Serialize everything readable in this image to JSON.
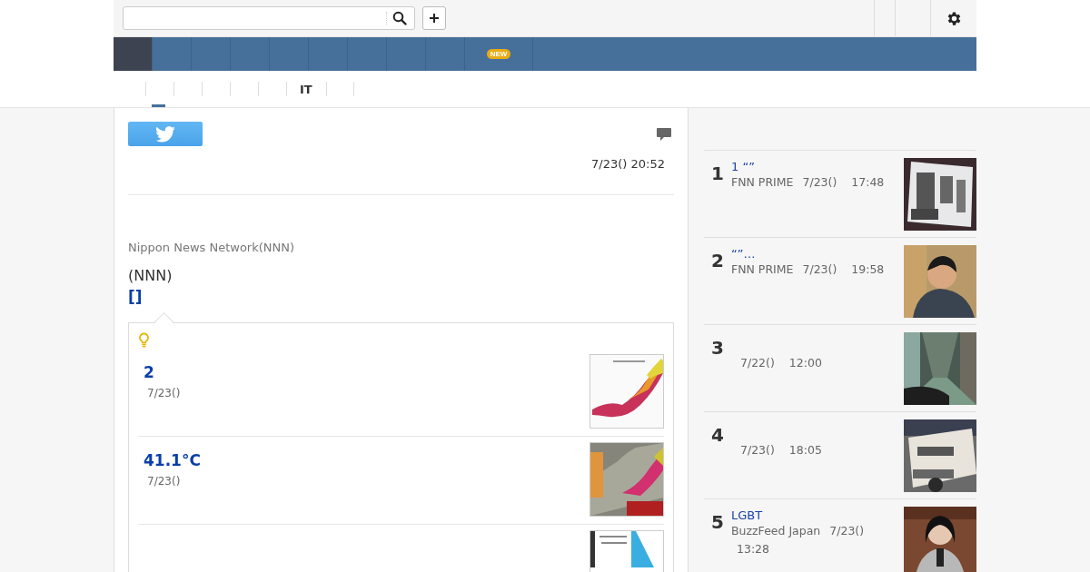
{
  "nav_tabs": [
    {
      "selected": true
    },
    {
      "selected": false
    },
    {
      "selected": false
    },
    {
      "selected": false
    },
    {
      "selected": false
    },
    {
      "selected": false
    },
    {
      "selected": false
    },
    {
      "selected": false
    },
    {
      "selected": false
    },
    {
      "selected": false,
      "badge": "NEW"
    }
  ],
  "sub_tabs": [
    {
      "selected": true
    },
    {
      "selected": false
    },
    {
      "selected": false
    },
    {
      "selected": false
    },
    {
      "selected": false
    },
    {
      "label": "IT",
      "selected": false
    },
    {
      "selected": false
    }
  ],
  "article": {
    "timestamp": "7/23() 20:52",
    "source": "Nippon News Network(NNN)",
    "body": "(NNN)",
    "link": "[]"
  },
  "related": [
    {
      "title": "2",
      "date": "7/23()",
      "kind": "picture"
    },
    {
      "title": "41.1°C",
      "date": "7/23()",
      "kind": "picture"
    },
    {
      "kind": "picture"
    }
  ],
  "ranking": [
    {
      "rank": "1",
      "title": "1 “”",
      "source": "FNN PRIME",
      "date": "7/23()",
      "time": "17:48",
      "kind": "picture"
    },
    {
      "rank": "2",
      "title": "“”…",
      "source": "FNN PRIME",
      "date": "7/23()",
      "time": "19:58",
      "kind": "picture"
    },
    {
      "rank": "3",
      "date": "7/22()",
      "time": "12:00",
      "kind": "picture"
    },
    {
      "rank": "4",
      "date": "7/23()",
      "time": "18:05",
      "kind": "picture"
    },
    {
      "rank": "5",
      "title": "LGBT",
      "source": "BuzzFeed Japan",
      "date": "7/23()",
      "time": "13:28",
      "kind": "picture"
    }
  ]
}
